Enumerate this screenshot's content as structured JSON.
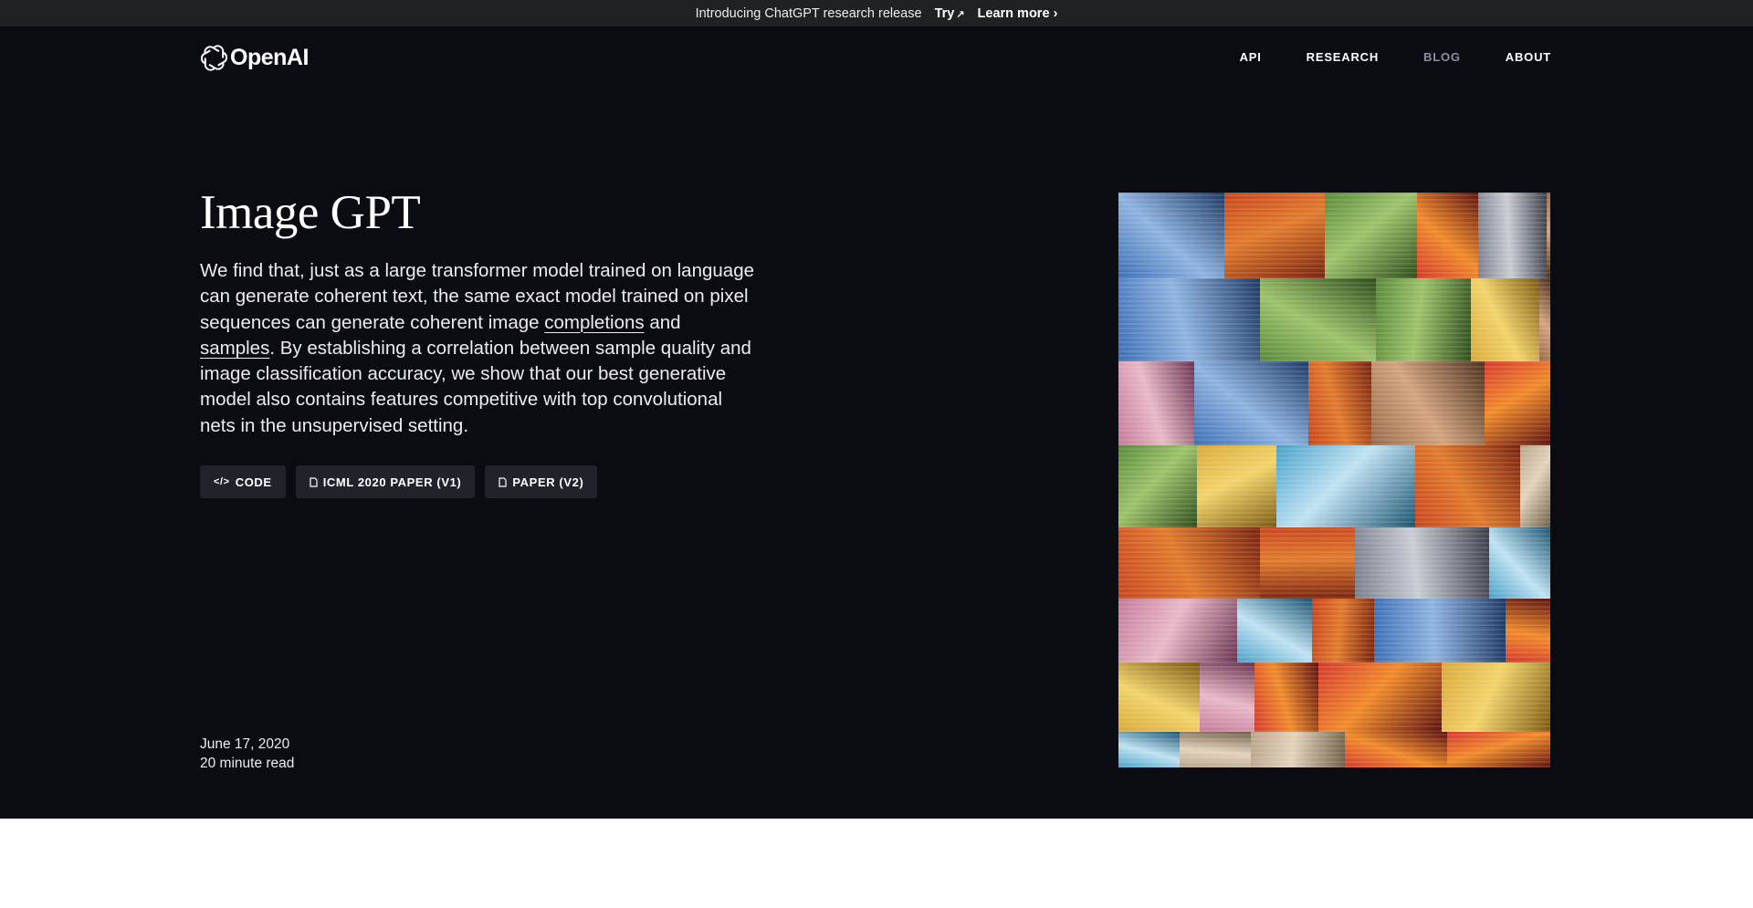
{
  "announcement": {
    "text": "Introducing ChatGPT research release",
    "try_label": "Try",
    "try_arrow": "↗",
    "learn_label": "Learn more",
    "learn_arrow": "›"
  },
  "nav": {
    "logo_text": "OpenAI",
    "links": [
      "API",
      "RESEARCH",
      "BLOG",
      "ABOUT"
    ]
  },
  "hero": {
    "title": "Image GPT",
    "desc_part1": "We find that, just as a large transformer model trained on language can generate coherent text, the same exact model trained on pixel sequences can generate coherent image ",
    "link_completions": "completions",
    "desc_and": " and ",
    "link_samples": "samples",
    "desc_part2": ". By establishing a correlation between sample quality and image classification accuracy, we show that our best generative model also contains features competitive with top convolutional nets in the unsupervised setting.",
    "buttons": [
      {
        "label": "CODE",
        "icon": "code-icon"
      },
      {
        "label": "ICML 2020 PAPER (V1)",
        "icon": "document-icon"
      },
      {
        "label": "PAPER (V2)",
        "icon": "document-icon"
      }
    ],
    "date": "June 17, 2020",
    "read_time": "20 minute read"
  },
  "colors": {
    "announce_bg": "#202123",
    "hero_bg": "#0b0b12",
    "button_bg": "#22232a",
    "nav_dim": "#8e8ea0"
  }
}
